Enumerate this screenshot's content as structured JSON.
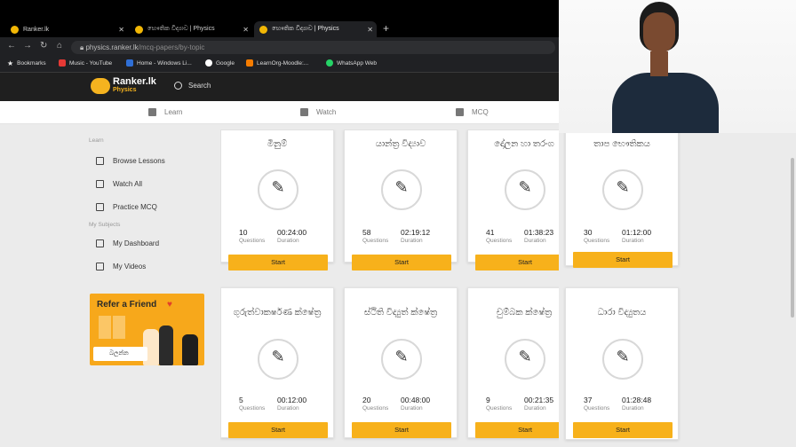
{
  "tabs": [
    {
      "label": "Ranker.lk"
    },
    {
      "label": "භෞතික විද්‍යාව | Physics"
    },
    {
      "label": "භෞතික විද්‍යාව | Physics"
    }
  ],
  "address": {
    "domain": "physics.ranker.lk",
    "path": "/mcq-papers/by-topic"
  },
  "bookmarks": [
    {
      "label": "Bookmarks",
      "color": "#f4f4f4"
    },
    {
      "label": "Music - YouTube",
      "color": "#e53935"
    },
    {
      "label": "Home - Windows Li...",
      "color": "#2f6fd6"
    },
    {
      "label": "Google",
      "color": "#ffffff"
    },
    {
      "label": "LearnOrg-Moodle:...",
      "color": "#f57c00"
    },
    {
      "label": "WhatsApp Web",
      "color": "#25d366"
    }
  ],
  "header": {
    "logo_main": "Ranker.lk",
    "logo_sub": "Physics",
    "search_label": "Search"
  },
  "topnav": [
    {
      "label": "Learn"
    },
    {
      "label": "Watch"
    },
    {
      "label": "MCQ"
    }
  ],
  "sidebar": {
    "learn_heading": "Learn",
    "learn_items": [
      {
        "label": "Browse Lessons"
      },
      {
        "label": "Watch All"
      },
      {
        "label": "Practice MCQ"
      }
    ],
    "subjects_heading": "My Subjects",
    "subject_items": [
      {
        "label": "My Dashboard"
      },
      {
        "label": "My Videos"
      }
    ]
  },
  "refer": {
    "title": "Refer a Friend",
    "button": "බලන්න"
  },
  "cards": [
    {
      "title": "මිනුම්",
      "questions": "10",
      "duration": "00:24:00"
    },
    {
      "title": "යාන්ත්‍ර විද්‍යාව",
      "questions": "58",
      "duration": "02:19:12"
    },
    {
      "title": "දෝලන හා තරංග",
      "questions": "41",
      "duration": "01:38:23"
    },
    {
      "title": "තාප භෞතිකය",
      "questions": "30",
      "duration": "01:12:00"
    },
    {
      "title": "ගුරුත්වාකර්ෂණ ක්ෂේත්‍ර",
      "questions": "5",
      "duration": "00:12:00"
    },
    {
      "title": "ස්ථිති විද්‍යුත් ක්ෂේත්‍ර",
      "questions": "20",
      "duration": "00:48:00"
    },
    {
      "title": "චුම්බක ක්ෂේත්‍ර",
      "questions": "9",
      "duration": "00:21:35"
    },
    {
      "title": "ධාරා විද්‍යුතය",
      "questions": "37",
      "duration": "01:28:48"
    }
  ],
  "labels": {
    "questions": "Questions",
    "duration": "Duration",
    "start": "Start"
  },
  "colors": {
    "accent": "#f7b11b",
    "header_bg": "#1f1f1f"
  }
}
